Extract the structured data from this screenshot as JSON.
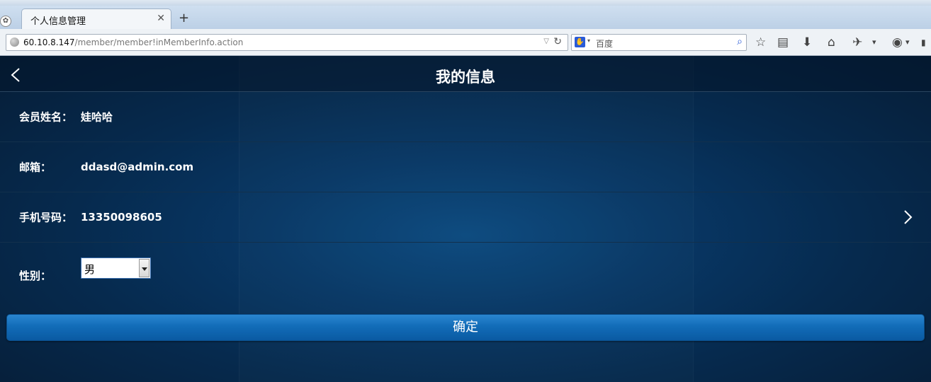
{
  "browser": {
    "tab_title": "个人信息管理",
    "url_host": "60.10.8.147",
    "url_path": "/member/member!inMemberInfo.action",
    "search_placeholder": "百度",
    "icons": [
      "globe-icon",
      "reload-icon",
      "baidu-icon",
      "search-icon",
      "star-icon",
      "reading-list-icon",
      "download-icon",
      "home-icon",
      "addon-icon",
      "menu-icon"
    ]
  },
  "page": {
    "title": "我的信息",
    "name_label": "会员姓名：",
    "name_value": "娃哈哈",
    "email_label": "邮箱：",
    "email_value": "ddasd@admin.com",
    "phone_label": "手机号码：",
    "phone_value": "13350098605",
    "gender_label": "性别：",
    "gender_value": "男",
    "confirm_label": "确定"
  },
  "colors": {
    "page_background": "#083765",
    "header_background": "#061d36",
    "button": "#126cb8",
    "text": "#ffffff"
  }
}
